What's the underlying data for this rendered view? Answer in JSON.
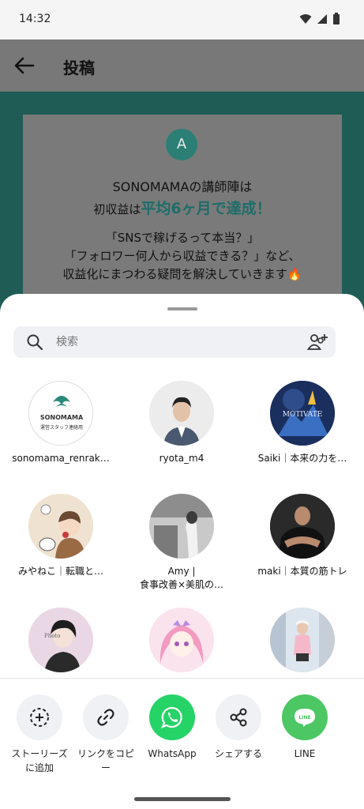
{
  "status_bar": {
    "time": "14:32"
  },
  "app_bar": {
    "title": "投稿"
  },
  "post": {
    "avatar_letter": "A",
    "line1": "SONOMAMAの講師陣は",
    "line2_prefix": "初収益は",
    "line2_highlight": "平均6ヶ月で達成！",
    "line3": "「SNSで稼げるって本当？」",
    "line4": "「フォロワー何人から収益できる？」など、",
    "line5": "収益化にまつわる疑問を解決していきます🔥"
  },
  "share_sheet": {
    "search": {
      "placeholder": "検索"
    },
    "contacts": [
      {
        "name": "sonomama_renrak…",
        "logo_text": "SONOMAMA",
        "logo_sub": "運営スタッフ連絡用"
      },
      {
        "name": "ryota_m4"
      },
      {
        "name": "Saiki｜本来の力を…",
        "avatar_text": "MOTIVATE"
      },
      {
        "name": "みやねこ｜転職と…"
      },
      {
        "name": "Amy |",
        "name_line2": "食事改善×美肌の…"
      },
      {
        "name": "maki｜本質の筋トレ"
      },
      {
        "name": "",
        "avatar_text": "Photo"
      },
      {
        "name": ""
      },
      {
        "name": ""
      }
    ],
    "actions": [
      {
        "label_line1": "ストーリーズ",
        "label_line2": "に追加",
        "icon": "add-to-story-icon"
      },
      {
        "label_line1": "リンクをコピ",
        "label_line2": "ー",
        "icon": "link-icon"
      },
      {
        "label_line1": "WhatsApp",
        "label_line2": "",
        "icon": "whatsapp-icon"
      },
      {
        "label_line1": "シェアする",
        "label_line2": "",
        "icon": "share-icon"
      },
      {
        "label_line1": "LINE",
        "label_line2": "",
        "icon": "line-icon",
        "badge": "LINE"
      }
    ]
  },
  "colors": {
    "teal": "#1f5c56",
    "whatsapp_green": "#25d366",
    "line_green": "#4cc764",
    "search_bg": "#eff1f4"
  }
}
